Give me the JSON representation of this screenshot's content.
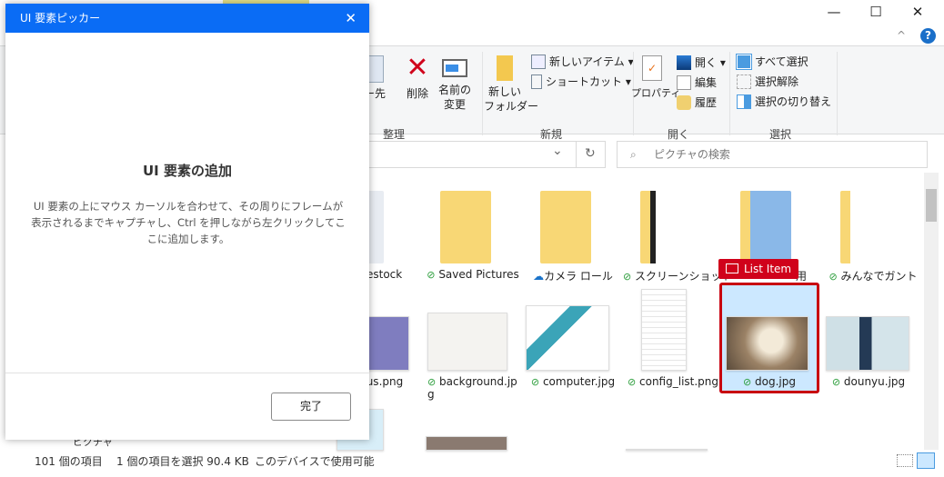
{
  "window": {
    "minimize": "—",
    "maximize": "☐",
    "close": "✕",
    "help": "?",
    "collapse": "^"
  },
  "ribbon": {
    "copy_to": "ー先",
    "delete": "削除",
    "rename": "名前の\n変更",
    "group_organize": "整理",
    "new_folder": "新しい\nフォルダー",
    "new_item": "新しいアイテム ▾",
    "shortcut": "ショートカット ▾",
    "group_new": "新規",
    "properties": "プロパティ",
    "open": "開く ▾",
    "edit": "編集",
    "history": "履歴",
    "group_open": "開く",
    "select_all": "すべて選択",
    "select_none": "選択解除",
    "invert": "選択の切り替え",
    "group_select": "選択"
  },
  "address": {
    "dropdown": "⌄",
    "refresh": "↻"
  },
  "search": {
    "placeholder": "ピクチャの検索"
  },
  "items_row1": [
    {
      "label": "estock",
      "status": ""
    },
    {
      "label": "Saved Pictures",
      "status": "synced"
    },
    {
      "label": "カメラ ロール",
      "status": "cloud"
    },
    {
      "label": "スクリーンショット",
      "status": "synced"
    },
    {
      "label": "用",
      "status": ""
    },
    {
      "label": "みんなでガント",
      "status": "synced"
    }
  ],
  "items_row2": [
    {
      "label": "tus.png",
      "status": ""
    },
    {
      "label": "background.jp\ng",
      "status": "synced"
    },
    {
      "label": "computer.jpg",
      "status": "synced"
    },
    {
      "label": "config_list.png",
      "status": "synced"
    },
    {
      "label": "dog.jpg",
      "status": "synced",
      "selected": true
    },
    {
      "label": "dounyu.jpg",
      "status": "synced"
    }
  ],
  "highlight": {
    "label": "List Item",
    "color": "#d0021b"
  },
  "status": {
    "count": "101 個の項目",
    "selected": "1 個の項目を選択  90.4 KB",
    "availability": "このデバイスで使用可能"
  },
  "nav_partial": "ピクチャ",
  "dialog": {
    "title": "UI 要素ピッカー",
    "close": "✕",
    "heading": "UI 要素の追加",
    "description": "UI 要素の上にマウス カーソルを合わせて、その周りにフレームが表示されるまでキャプチャし、Ctrl を押しながら左クリックしてここに追加します。",
    "done": "完了",
    "accent": "#0a6cf5"
  }
}
